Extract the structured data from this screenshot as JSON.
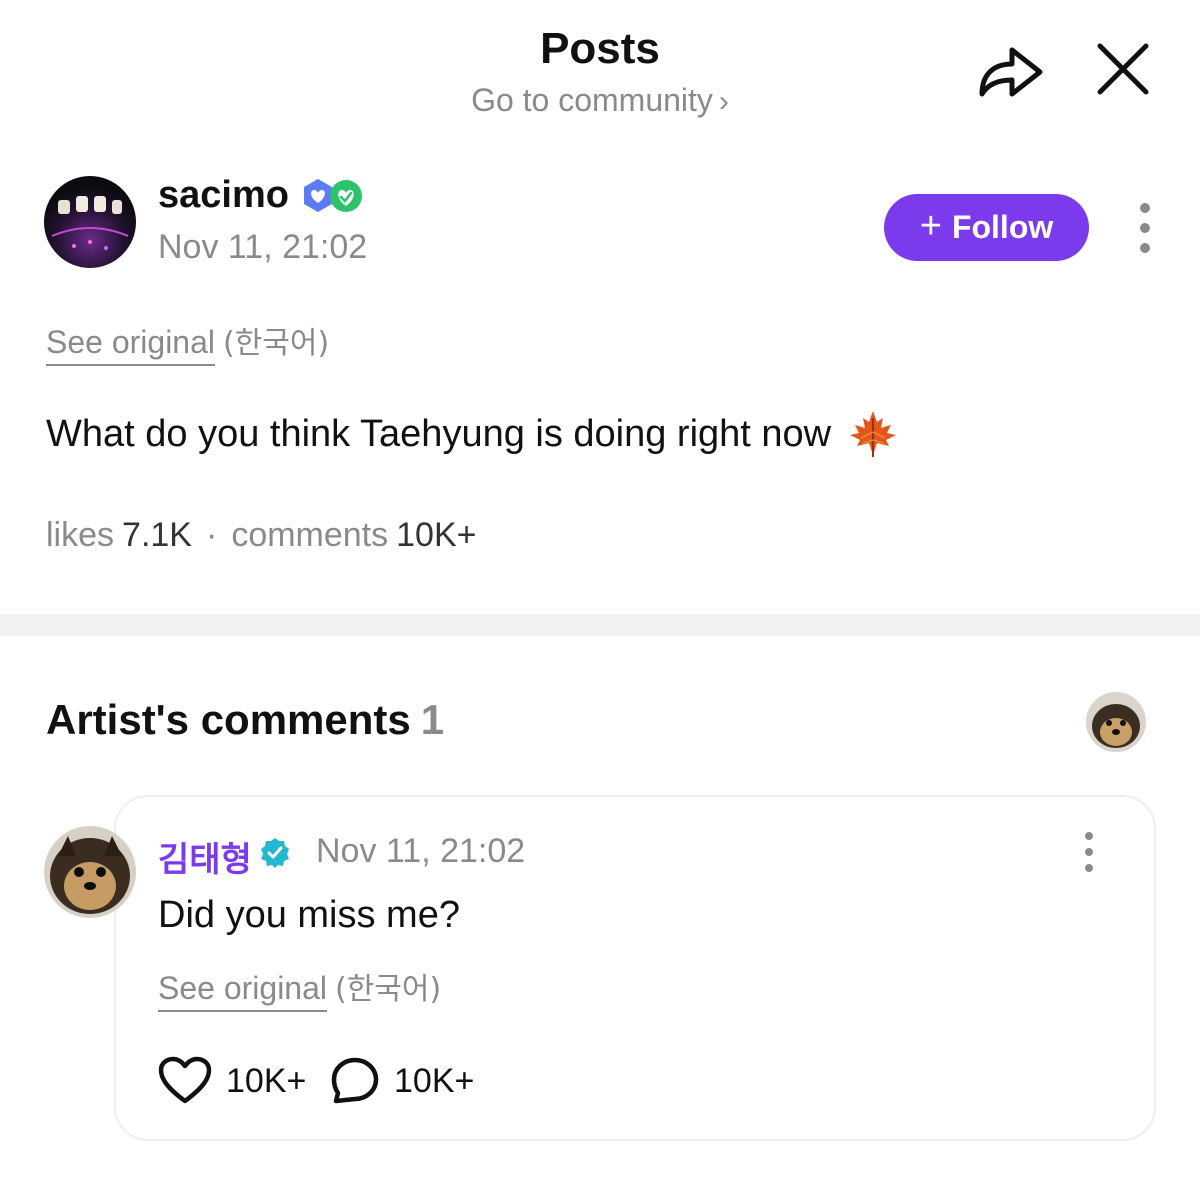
{
  "header": {
    "title": "Posts",
    "subtitle": "Go to community",
    "subtitle_chevron": "›",
    "share_icon": "share-arrow-icon",
    "close_icon": "close-icon"
  },
  "post": {
    "author": {
      "username": "sacimo",
      "timestamp": "Nov 11, 21:02",
      "badges": [
        "membership-heart-badge",
        "fan-heart-badge"
      ]
    },
    "follow_label": "Follow",
    "follow_plus": "+",
    "see_original": {
      "link": "See original",
      "lang": "(한국어)"
    },
    "body": "What do you think Taehyung is doing right now",
    "emoji_icon": "maple-leaf-icon",
    "stats": {
      "likes_label": "likes",
      "likes_value": "7.1K",
      "separator": "·",
      "comments_label": "comments",
      "comments_value": "10K+"
    }
  },
  "artist_comments": {
    "title": "Artist's comments",
    "count": "1",
    "comment": {
      "author": "김태형",
      "verified_icon": "verified-badge-icon",
      "timestamp": "Nov 11, 21:02",
      "body": "Did you miss me?",
      "see_original": {
        "link": "See original",
        "lang": "(한국어)"
      },
      "likes": "10K+",
      "replies": "10K+"
    }
  },
  "colors": {
    "accent": "#7c3aed",
    "muted": "#8a8a8a",
    "divider": "#f1f1f1",
    "verified": "#22b8cf"
  }
}
